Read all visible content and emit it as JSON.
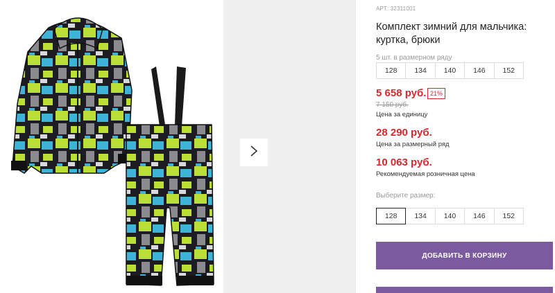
{
  "product": {
    "sku": "АРТ: 32311001",
    "title": "Комплект зимний для мальчика: куртка, брюки"
  },
  "size_range": {
    "label": "5 шт. в размерном ряду",
    "sizes": [
      "128",
      "134",
      "140",
      "146",
      "152"
    ]
  },
  "pricing": {
    "unit_price": "5 658 руб.",
    "discount": "21%",
    "old_price": "7 150 руб.",
    "unit_caption": "Цена за единицу",
    "range_price": "28 290 руб.",
    "range_caption": "Цена за размерный ряд",
    "retail_price": "10 063 руб.",
    "retail_caption": "Рекомендуемая розничная цена"
  },
  "size_select": {
    "label": "Выберите размер:",
    "options": [
      "128",
      "134",
      "140",
      "146",
      "152"
    ],
    "selected": "128"
  },
  "actions": {
    "add_to_cart": "ДОБАВИТЬ В КОРЗИНУ"
  },
  "icons": {
    "gallery_next": "chevron-right-icon"
  },
  "colors": {
    "price_red": "#d6282e",
    "button_purple": "#7b5a9f",
    "print_lime": "#b9e033",
    "print_cyan": "#3fb2d8",
    "print_dark": "#1c1c22"
  }
}
